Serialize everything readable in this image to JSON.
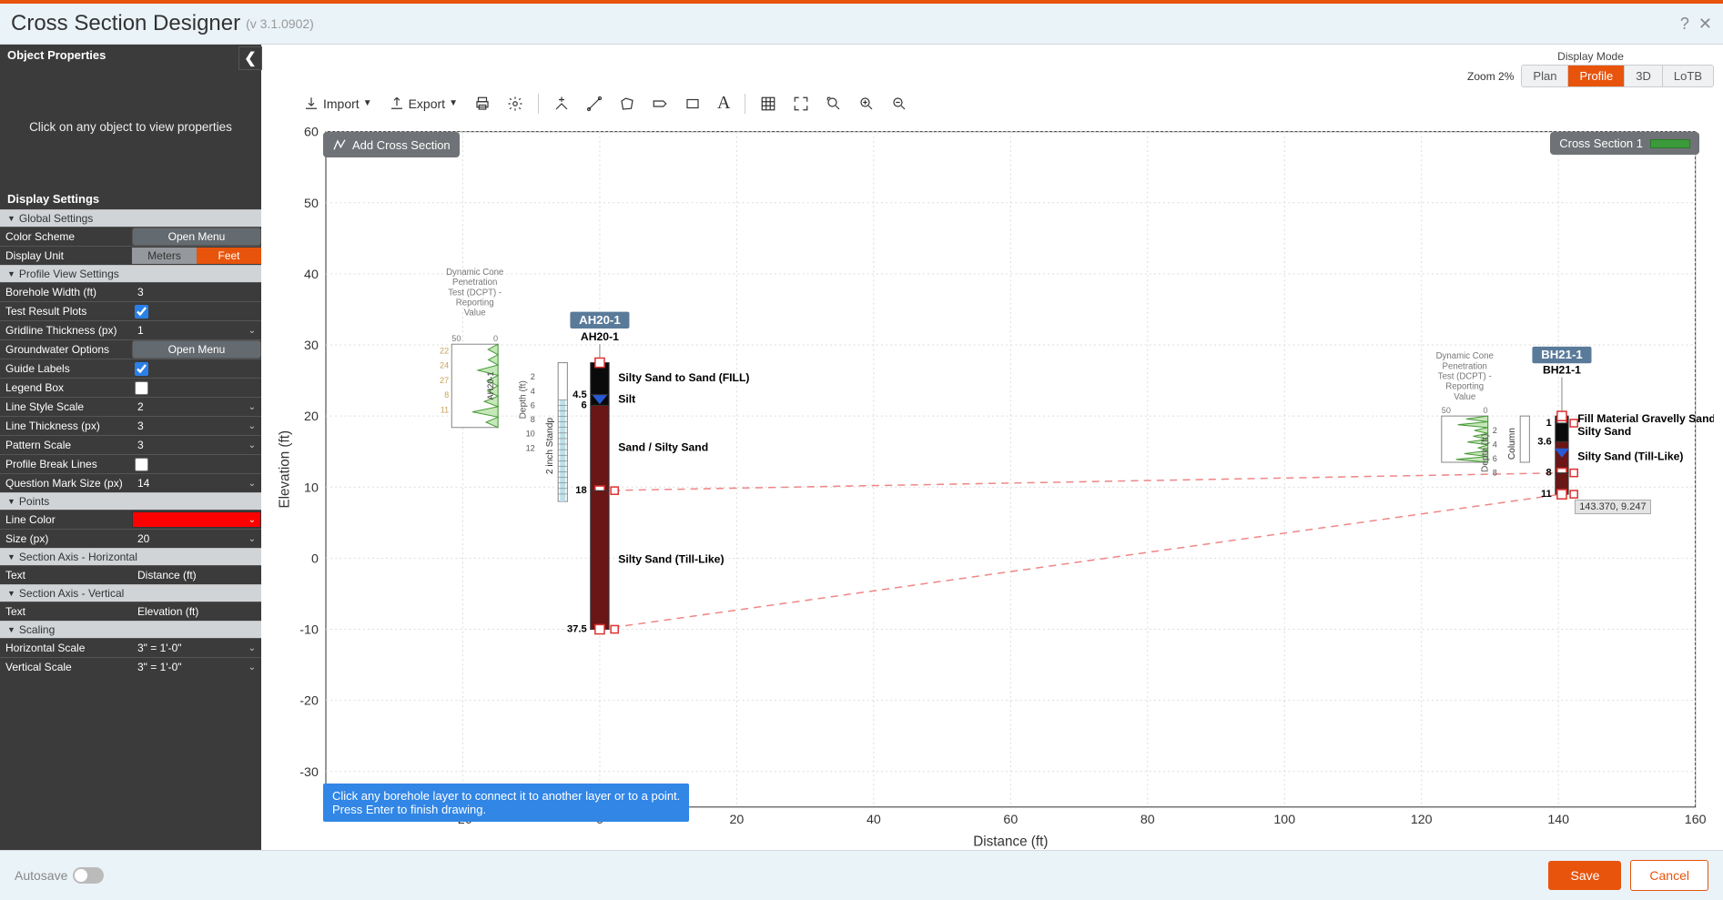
{
  "header": {
    "title": "Cross Section Designer",
    "version": "(v 3.1.0902)"
  },
  "side": {
    "obj_prop_header": "Object Properties",
    "placeholder": "Click on any object to view properties",
    "display_settings_header": "Display Settings",
    "groups": {
      "global": "Global Settings",
      "profile": "Profile View Settings",
      "points": "Points",
      "axis_h": "Section Axis - Horizontal",
      "axis_v": "Section Axis - Vertical",
      "scaling": "Scaling"
    },
    "rows": {
      "color_scheme": {
        "label": "Color Scheme",
        "btn": "Open Menu"
      },
      "display_unit": {
        "label": "Display Unit",
        "meters": "Meters",
        "feet": "Feet"
      },
      "borehole_width": {
        "label": "Borehole Width (ft)",
        "value": "3"
      },
      "test_plots": {
        "label": "Test Result Plots",
        "checked": true
      },
      "gridline_thickness": {
        "label": "Gridline Thickness (px)",
        "value": "1"
      },
      "groundwater": {
        "label": "Groundwater Options",
        "btn": "Open Menu"
      },
      "guide_labels": {
        "label": "Guide Labels",
        "checked": true
      },
      "legend_box": {
        "label": "Legend Box",
        "checked": false
      },
      "line_style_scale": {
        "label": "Line Style Scale",
        "value": "2"
      },
      "line_thickness": {
        "label": "Line Thickness (px)",
        "value": "3"
      },
      "pattern_scale": {
        "label": "Pattern Scale",
        "value": "3"
      },
      "profile_break": {
        "label": "Profile Break Lines",
        "checked": false
      },
      "qmark_size": {
        "label": "Question Mark Size (px)",
        "value": "14"
      },
      "line_color": {
        "label": "Line Color",
        "color": "#ff0000"
      },
      "point_size": {
        "label": "Size (px)",
        "value": "20"
      },
      "axis_h_text": {
        "label": "Text",
        "value": "Distance (ft)"
      },
      "axis_v_text": {
        "label": "Text",
        "value": "Elevation (ft)"
      },
      "h_scale": {
        "label": "Horizontal Scale",
        "value": "3\" = 1'-0\""
      },
      "v_scale": {
        "label": "Vertical Scale",
        "value": "3\" = 1'-0\""
      }
    }
  },
  "toolbar": {
    "import": "Import",
    "export": "Export",
    "zoom_label": "Zoom 2%",
    "display_mode_label": "Display Mode",
    "modes": {
      "plan": "Plan",
      "profile": "Profile",
      "d3": "3D",
      "lotb": "LoTB"
    }
  },
  "canvas": {
    "add_cs": "Add Cross Section",
    "cs_badge": "Cross Section 1",
    "hint_line1": "Click any borehole layer to connect it to another layer or to a point.",
    "hint_line2": "Press Enter to finish drawing.",
    "tooltip_coord": "143.370, 9.247"
  },
  "chart_data": {
    "type": "profile",
    "xlabel": "Distance (ft)",
    "ylabel": "Elevation (ft)",
    "xlim": [
      -40,
      160
    ],
    "ylim": [
      -35,
      60
    ],
    "x_ticks": [
      -20,
      0,
      20,
      40,
      60,
      80,
      100,
      120,
      140,
      160
    ],
    "y_ticks": [
      -30,
      -20,
      -10,
      0,
      10,
      20,
      30,
      40,
      50,
      60
    ],
    "boreholes": [
      {
        "name": "AH20-1",
        "tag": "AH20-1",
        "x": 0,
        "top_elev": 27.5,
        "depth_axis_label": "Depth (ft)",
        "depth_ruler": [
          2,
          4,
          6,
          8,
          10,
          12
        ],
        "standpipe_label": "2 inch Standp",
        "dcpt_header": "Dynamic Cone Penetration Test (DCPT) - Reporting Value",
        "dcpt_range": [
          50,
          0
        ],
        "dcpt_ticks": [
          22,
          24,
          27,
          8,
          11
        ],
        "layers": [
          {
            "depth": 4.5,
            "desc": "Silty Sand to Sand (FILL)"
          },
          {
            "depth": 6,
            "desc": "Silt"
          },
          {
            "depth": 18,
            "desc": "Sand / Silty Sand",
            "marker": true
          },
          {
            "depth": 37.5,
            "desc": "Silty Sand (Till-Like)",
            "marker": true
          }
        ]
      },
      {
        "name": "BH21-1",
        "tag": "BH21-1",
        "x": 140.5,
        "top_elev": 20,
        "depth_axis_label": "Depth (ft)",
        "column_label": "Column",
        "depth_ruler": [
          2,
          4,
          6,
          8
        ],
        "dcpt_header": "Dynamic Cone Penetration Test (DCPT) - Reporting Value",
        "dcpt_range": [
          50,
          0
        ],
        "layers": [
          {
            "depth": 1,
            "desc": "Fill Material Gravelly Sand",
            "marker": true
          },
          {
            "depth": 3.6,
            "desc": "Silty Sand"
          },
          {
            "depth": 8,
            "desc": "Silty Sand (Till-Like)",
            "marker": true
          },
          {
            "depth": 11,
            "desc": "",
            "marker": true
          }
        ]
      }
    ],
    "cross_section_links": [
      {
        "from_bh": 0,
        "from_depth": 18,
        "to_bh": 1,
        "to_depth": 8
      },
      {
        "from_bh": 0,
        "from_depth": 37.5,
        "to_bh": 1,
        "to_depth": 11
      }
    ]
  },
  "footer": {
    "autosave": "Autosave",
    "save": "Save",
    "cancel": "Cancel"
  }
}
